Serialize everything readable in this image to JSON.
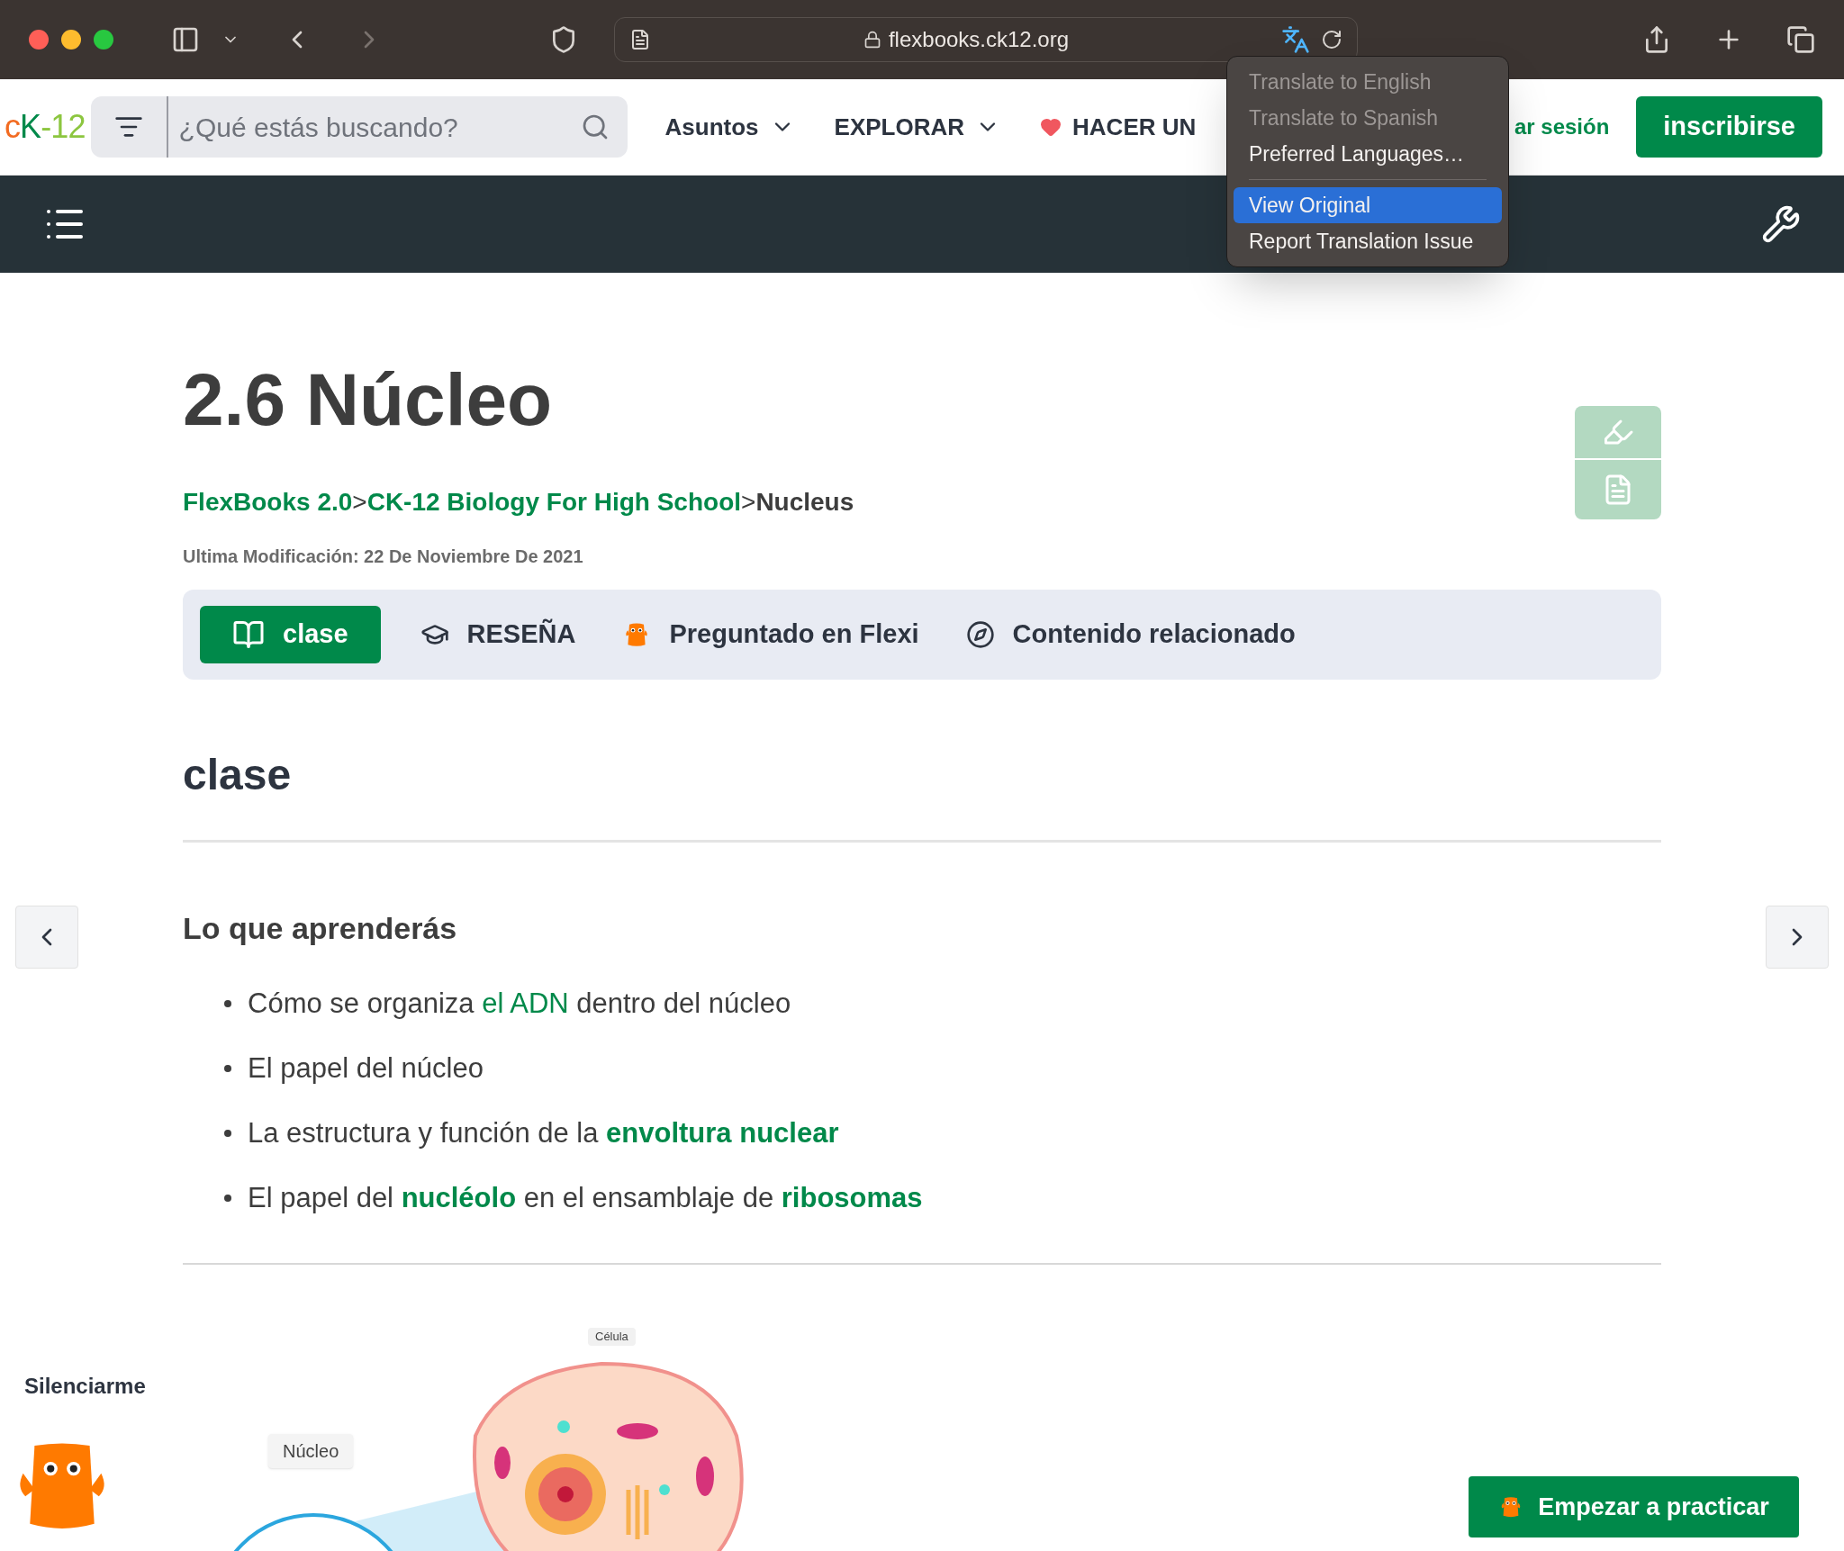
{
  "browser": {
    "url": "flexbooks.ck12.org",
    "translate_menu": [
      {
        "kind": "item",
        "label": "Translate to English",
        "disabled": true,
        "selected": false
      },
      {
        "kind": "item",
        "label": "Translate to Spanish",
        "disabled": true,
        "selected": false
      },
      {
        "kind": "item",
        "label": "Preferred Languages…",
        "disabled": false,
        "selected": false
      },
      {
        "kind": "separator"
      },
      {
        "kind": "item",
        "label": "View Original",
        "disabled": false,
        "selected": true
      },
      {
        "kind": "item",
        "label": "Report Translation Issue",
        "disabled": false,
        "selected": false
      }
    ]
  },
  "header": {
    "logo": [
      "c",
      "K",
      "-12"
    ],
    "search": {
      "placeholder": "¿Qué estás buscando?"
    },
    "nav": [
      {
        "kind": "menu",
        "label": "Asuntos"
      },
      {
        "kind": "menu",
        "label": "EXPLORAR"
      },
      {
        "kind": "donate",
        "label": "HACER UN"
      }
    ],
    "sign_in": "ar sesión",
    "sign_up": "inscribirse"
  },
  "content": {
    "title": "2.6 Núcleo",
    "breadcrumb": [
      {
        "kind": "link",
        "label": "FlexBooks 2.0"
      },
      {
        "kind": "sep",
        "label": ">"
      },
      {
        "kind": "link",
        "label": "CK-12 Biology For High School"
      },
      {
        "kind": "sep",
        "label": ">"
      },
      {
        "kind": "current",
        "label": "Nucleus"
      }
    ],
    "modified": "Ultima Modificación: 22 De Noviembre De 2021",
    "tabs": [
      {
        "label": "clase",
        "selected": true
      },
      {
        "label": "RESEÑA",
        "selected": false
      },
      {
        "label": "Preguntado en Flexi",
        "selected": false
      },
      {
        "label": "Contenido relacionado",
        "selected": false
      }
    ],
    "section_title": "clase",
    "learn_title": "Lo que aprenderás",
    "learn_items": [
      [
        {
          "kind": "plain",
          "text": "Cómo se organiza "
        },
        {
          "kind": "link",
          "text": "el ADN"
        },
        {
          "kind": "plain",
          "text": " dentro del núcleo"
        }
      ],
      [
        {
          "kind": "plain",
          "text": "El papel del núcleo"
        }
      ],
      [
        {
          "kind": "plain",
          "text": "La estructura y función de la "
        },
        {
          "kind": "term",
          "text": "envoltura nuclear"
        }
      ],
      [
        {
          "kind": "plain",
          "text": "El papel del "
        },
        {
          "kind": "term",
          "text": "nucléolo"
        },
        {
          "kind": "plain",
          "text": " en el ensamblaje de "
        },
        {
          "kind": "term",
          "text": "ribosomas"
        }
      ]
    ],
    "figure": {
      "cell_label": "Célula",
      "nucleus_label": "Núcleo"
    }
  },
  "mute_label": "Silenciarme",
  "practice_button": "Empezar a practicar"
}
